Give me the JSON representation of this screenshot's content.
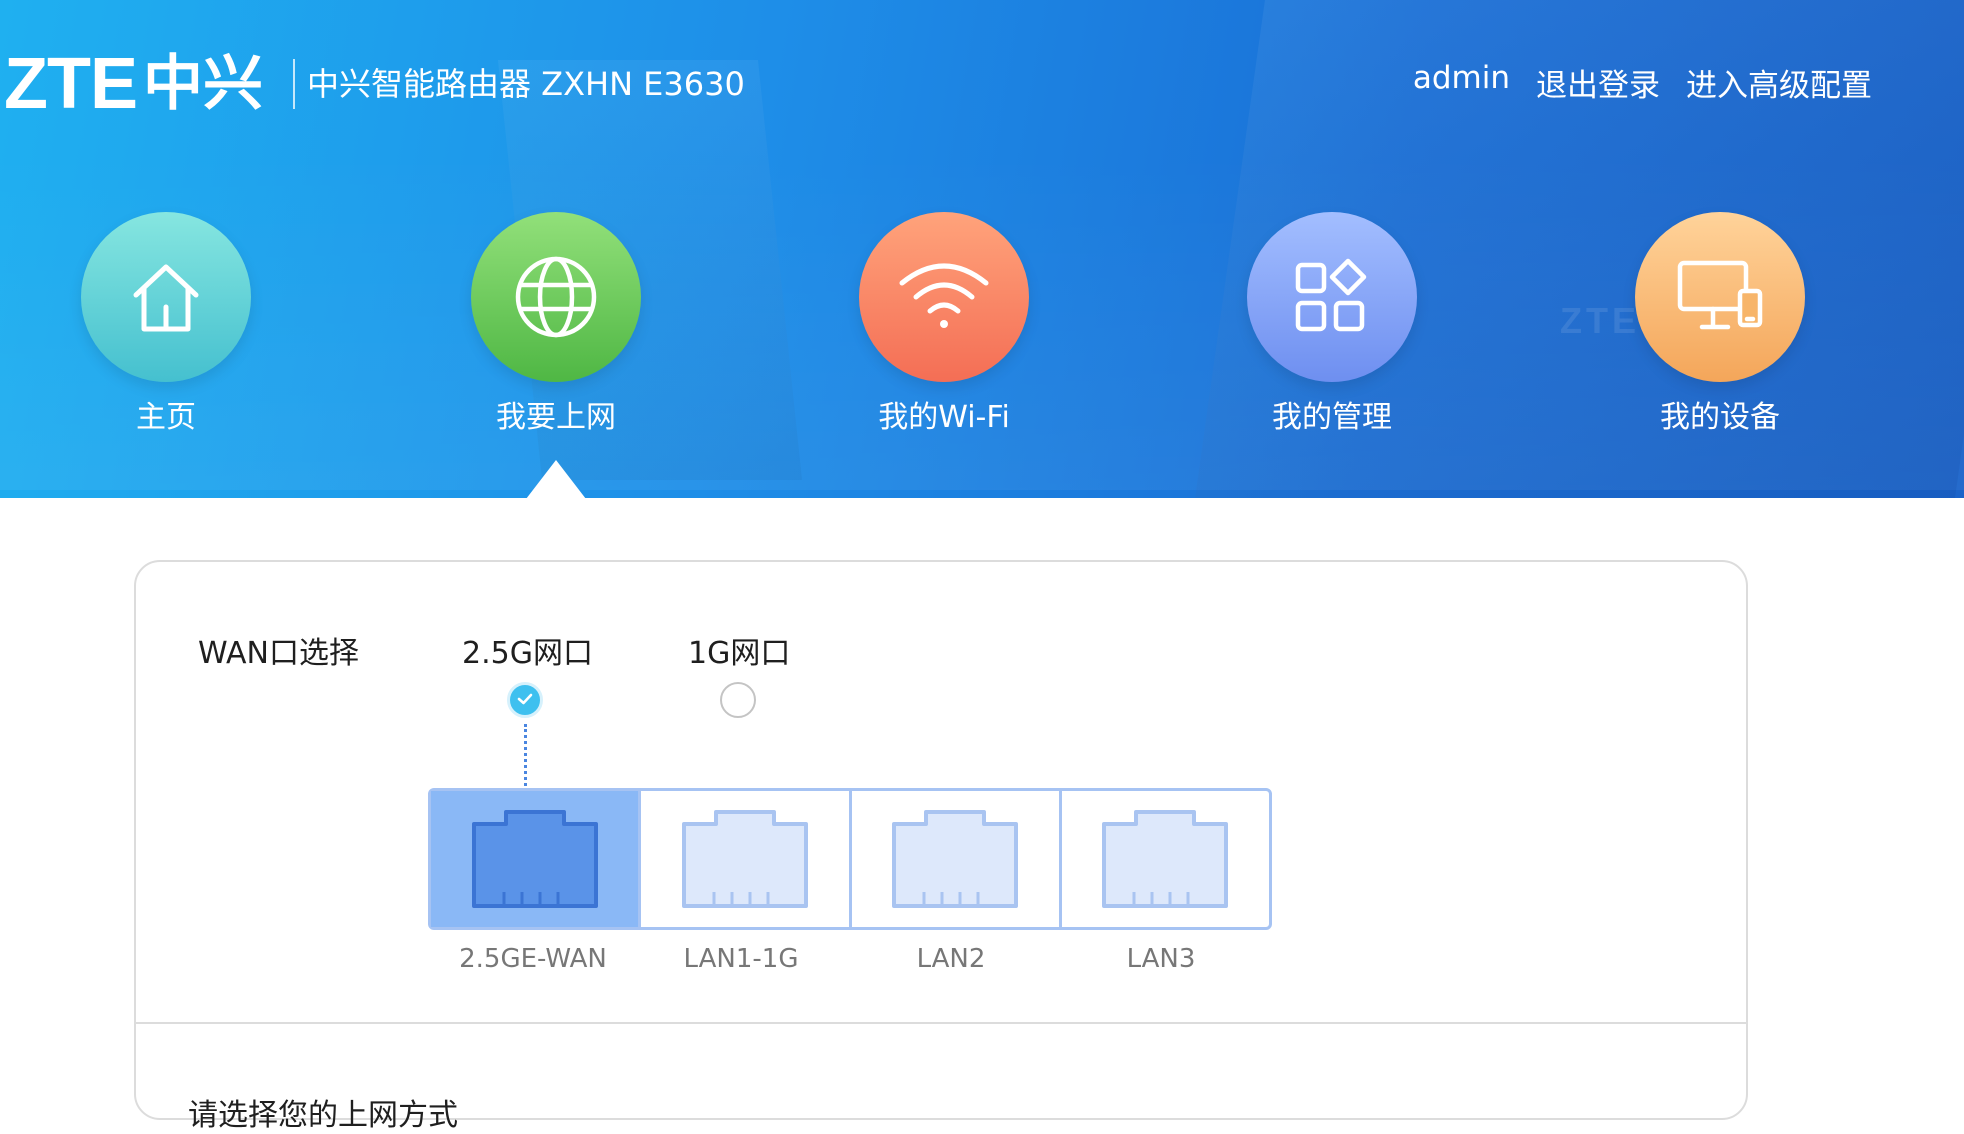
{
  "header": {
    "logo_text": "ZTE",
    "logo_cn": "中兴",
    "product_name": "中兴智能路由器 ZXHN E3630",
    "watermark": "ZTE",
    "user": "admin",
    "logout": "退出登录",
    "advanced": "进入高级配置"
  },
  "menu": [
    {
      "label": "主页",
      "icon": "home-icon",
      "color": "#5fd3d7"
    },
    {
      "label": "我要上网",
      "icon": "globe-icon",
      "color": "#6cc95a",
      "selected": true
    },
    {
      "label": "我的Wi-Fi",
      "icon": "wifi-icon",
      "color": "#fb8a66"
    },
    {
      "label": "我的管理",
      "icon": "apps-icon",
      "color": "#86a8f7"
    },
    {
      "label": "我的设备",
      "icon": "devices-icon",
      "color": "#f9bd74"
    }
  ],
  "wan": {
    "label": "WAN口选择",
    "options": [
      {
        "label": "2.5G网口",
        "checked": true
      },
      {
        "label": "1G网口",
        "checked": false
      }
    ],
    "ports": [
      {
        "label": "2.5GE-WAN",
        "active": true
      },
      {
        "label": "LAN1-1G",
        "active": false
      },
      {
        "label": "LAN2",
        "active": false
      },
      {
        "label": "LAN3",
        "active": false
      }
    ]
  },
  "bottom_text": "请选择您的上网方式"
}
